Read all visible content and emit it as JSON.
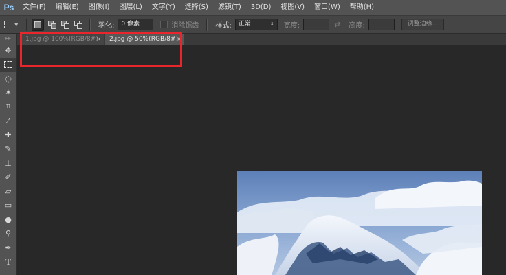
{
  "app": {
    "logo": "Ps"
  },
  "menu": [
    "文件(F)",
    "编辑(E)",
    "图像(I)",
    "图层(L)",
    "文字(Y)",
    "选择(S)",
    "滤镜(T)",
    "3D(D)",
    "视图(V)",
    "窗口(W)",
    "帮助(H)"
  ],
  "options": {
    "feather_label": "羽化:",
    "feather_value": "0 像素",
    "antialias_label": "消除锯齿",
    "style_label": "样式:",
    "style_value": "正常",
    "width_label": "宽度:",
    "height_label": "高度:",
    "refine_button": "调整边缘..."
  },
  "tabs": [
    {
      "label": "1.jpg @ 100%(RGB/8#)",
      "close": "×",
      "active": false
    },
    {
      "label": "2.jpg @ 50%(RGB/8#)",
      "close": "×",
      "active": true
    }
  ],
  "toolbar": {
    "tools": [
      "move-tool",
      "rect-marquee-tool",
      "lasso-tool",
      "magic-wand-tool",
      "crop-tool",
      "eyedropper-tool",
      "healing-brush-tool",
      "brush-tool",
      "clone-stamp-tool",
      "history-brush-tool",
      "eraser-tool",
      "gradient-tool",
      "blur-tool",
      "dodge-tool",
      "pen-tool",
      "type-tool"
    ],
    "active_tool": "rect-marquee-tool"
  },
  "colors": {
    "highlight": "#e8262b",
    "logo": "#9bd0ff",
    "sky": "#6c8fc4"
  }
}
